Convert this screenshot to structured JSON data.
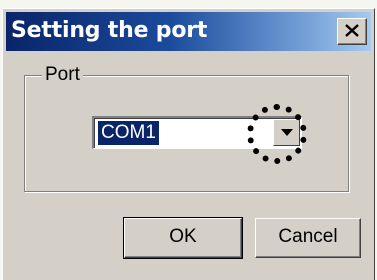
{
  "dialog": {
    "title": "Setting the port",
    "close_icon": "close-icon"
  },
  "port_group": {
    "label": "Port",
    "combo": {
      "selected_value": "COM1",
      "dropdown_icon": "chevron-down-icon"
    }
  },
  "buttons": {
    "ok_label": "OK",
    "cancel_label": "Cancel"
  },
  "annotation": {
    "highlight": "dotted-circle",
    "color": "#000000"
  }
}
